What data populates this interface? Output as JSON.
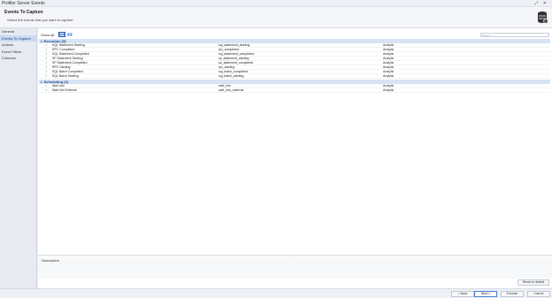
{
  "window": {
    "title": "Profiler Server Events",
    "buttons": [
      "⤢",
      "✕"
    ]
  },
  "header": {
    "title": "Events To Capture",
    "subtitle": "Select the events that you want to capture."
  },
  "sidebar": {
    "items": [
      {
        "label": "General",
        "active": false
      },
      {
        "label": "Events To Capture",
        "active": true
      },
      {
        "label": "Actions",
        "active": false
      },
      {
        "label": "Event Filters",
        "active": false
      },
      {
        "label": "Columns",
        "active": false
      }
    ]
  },
  "toolbar": {
    "show_all_label": "Show all:",
    "search_placeholder": "Search"
  },
  "groups": [
    {
      "label": "Execution (9)",
      "rows": [
        {
          "name": "SQL Statement Starting",
          "identifier": "sql_statement_starting",
          "category": "Analytic"
        },
        {
          "name": "RPC Completed",
          "identifier": "rpc_completed",
          "category": "Analytic"
        },
        {
          "name": "SQL Statement Completed",
          "identifier": "sql_statement_completed",
          "category": "Analytic"
        },
        {
          "name": "SP Statement Starting",
          "identifier": "sp_statement_starting",
          "category": "Analytic"
        },
        {
          "name": "SP Statement Completed",
          "identifier": "sp_statement_completed",
          "category": "Analytic"
        },
        {
          "name": "RPC Starting",
          "identifier": "rpc_starting",
          "category": "Analytic"
        },
        {
          "name": "SQL Batch Completed",
          "identifier": "sql_batch_completed",
          "category": "Analytic"
        },
        {
          "name": "SQL Batch Starting",
          "identifier": "sql_batch_starting",
          "category": "Analytic"
        }
      ]
    },
    {
      "label": "Scheduling (2)",
      "rows": [
        {
          "name": "Wait Info",
          "identifier": "wait_info",
          "category": "Analytic"
        },
        {
          "name": "Wait Info External",
          "identifier": "wait_info_external",
          "category": "Analytic"
        }
      ]
    }
  ],
  "description": {
    "label": "Description"
  },
  "reset_label": "Reset to default",
  "footer": {
    "back_label": "< Back",
    "next_label": "Next >",
    "execute_label": "Execute",
    "cancel_label": "Cancel"
  },
  "colors": {
    "accent": "#3b78d8",
    "sidebar_active": "#c9daf3",
    "group_header": "#d8e3f3"
  }
}
